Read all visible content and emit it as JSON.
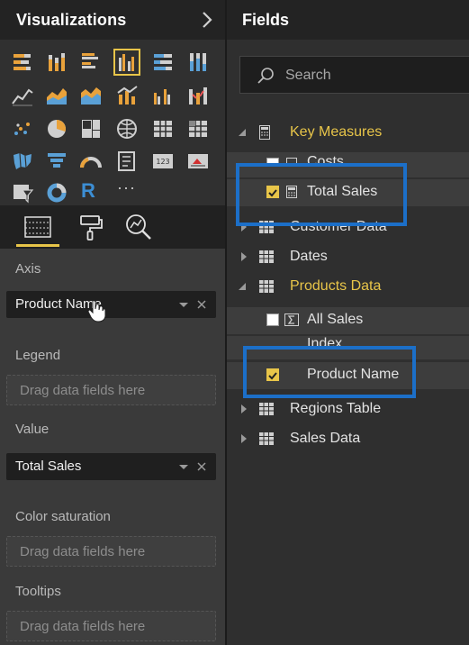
{
  "visualizations": {
    "title": "Visualizations",
    "gallery_icons": [
      "stacked-bar-icon",
      "stacked-column-icon",
      "clustered-bar-icon",
      "clustered-column-icon",
      "100-stacked-bar-icon",
      "100-stacked-column-icon",
      "line-chart-icon",
      "area-chart-icon",
      "stacked-area-icon",
      "line-column-icon",
      "line-clustered-column-icon",
      "ribbon-chart-icon",
      "scatter-chart-icon",
      "pie-chart-icon",
      "treemap-icon",
      "map-icon",
      "table-icon",
      "matrix-icon",
      "filled-map-icon",
      "funnel-icon",
      "gauge-icon",
      "multi-row-card-icon",
      "card-icon",
      "kpi-icon",
      "slicer-icon",
      "donut-icon",
      "r-visual-icon",
      "more-icon"
    ],
    "selected_visual": "clustered-column-icon",
    "r_label": "R",
    "more_label": "···",
    "tabs": [
      "fields-tab",
      "format-tab",
      "analytics-tab"
    ],
    "wells": {
      "axis_label": "Axis",
      "axis_value": "Product Name",
      "legend_label": "Legend",
      "legend_placeholder": "Drag data fields here",
      "value_label": "Value",
      "value_value": "Total Sales",
      "color_saturation_label": "Color saturation",
      "color_saturation_placeholder": "Drag data fields here",
      "tooltips_label": "Tooltips",
      "tooltips_placeholder": "Drag data fields here"
    }
  },
  "fields": {
    "title": "Fields",
    "search_placeholder": "Search",
    "tree": [
      {
        "label": "Key Measures",
        "expanded": true,
        "highlight": true
      },
      {
        "label": "Costs",
        "checked": false
      },
      {
        "label": "Total Sales",
        "checked": true
      },
      {
        "label": "Customer Data",
        "expanded": false
      },
      {
        "label": "Dates",
        "expanded": false
      },
      {
        "label": "Products Data",
        "expanded": true,
        "highlight": true
      },
      {
        "label": "All Sales",
        "checked": false
      },
      {
        "label": "Index",
        "checked": false
      },
      {
        "label": "Product Name",
        "checked": true
      },
      {
        "label": "Regions Table",
        "expanded": false
      },
      {
        "label": "Sales Data",
        "expanded": false
      }
    ]
  },
  "colors": {
    "accent": "#e8c549",
    "annotation_blue": "#1c6fc8",
    "panel_bg": "#3a3a3a",
    "header_bg": "#232323"
  }
}
